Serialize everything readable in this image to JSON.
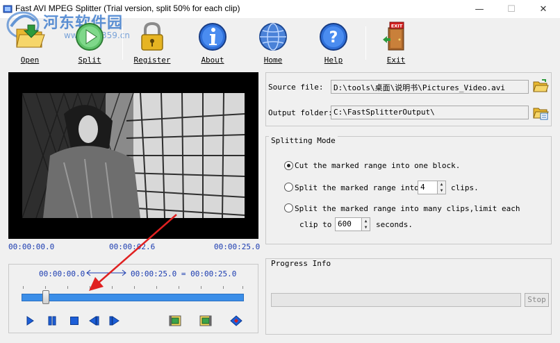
{
  "window": {
    "title": "Fast AVI MPEG Splitter (Trial version, split 50% for each clip)",
    "minimize": "—",
    "maximize": "☐",
    "close": "✕"
  },
  "watermark": {
    "text": "河东软件园",
    "url": "www.pc0359.cn"
  },
  "toolbar": {
    "open": "Open",
    "split": "Split",
    "register": "Register",
    "about": "About",
    "home": "Home",
    "help": "Help",
    "exit": "Exit"
  },
  "player": {
    "time_start": "00:00:00.0",
    "time_current": "00:00:02.6",
    "time_end": "00:00:25.0",
    "range_start": "00:00:00.0",
    "range_text": "00:00:25.0 = 00:00:25.0",
    "slider_position": 0.11
  },
  "files": {
    "source_label": "Source file:",
    "source_value": "D:\\tools\\桌面\\说明书\\Pictures_Video.avi",
    "output_label": "Output folder:",
    "output_value": "C:\\FastSplitterOutput\\"
  },
  "mode": {
    "legend": "Splitting Mode",
    "option1": "Cut the marked range into one block.",
    "option2_prefix": "Split the marked range into",
    "option2_value": "4",
    "option2_suffix": "clips.",
    "option3_line1": "Split the marked range into many clips,limit each",
    "option3_prefix": "clip to",
    "option3_value": "600",
    "option3_suffix": "seconds.",
    "selected": 1
  },
  "progress": {
    "legend": "Progress Info",
    "stop": "Stop",
    "value": 0
  },
  "colors": {
    "accent_blue": "#1a3bb0",
    "slider_blue": "#3b8ee8",
    "arrow_red": "#e02020"
  }
}
